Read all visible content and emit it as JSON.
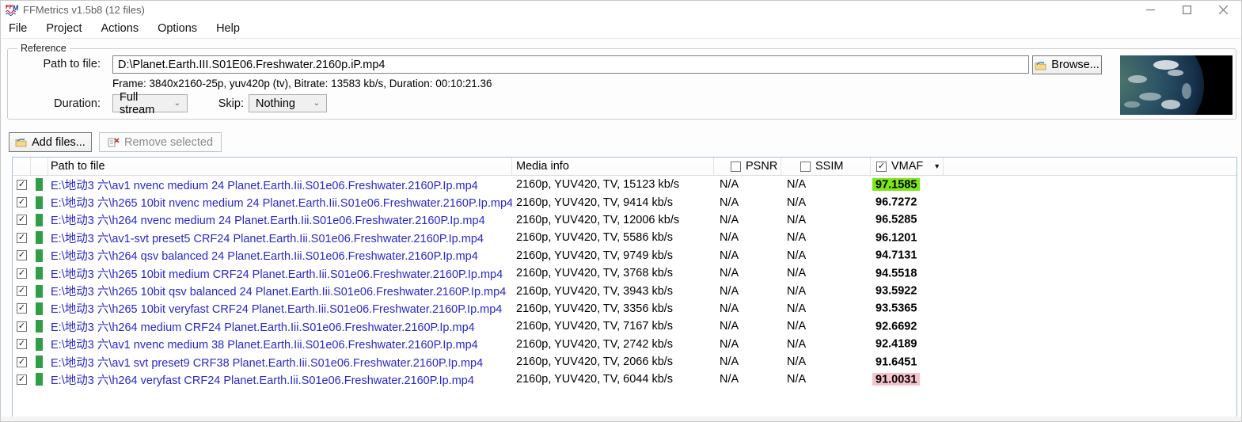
{
  "window": {
    "title": "FFMetrics v1.5b8 (12 files)",
    "icon": "ffmetrics-logo",
    "controls": {
      "minimize": "minimize-button",
      "maximize": "maximize-button",
      "close": "close-button"
    }
  },
  "menu": {
    "items": [
      {
        "label": "File"
      },
      {
        "label": "Project"
      },
      {
        "label": "Actions"
      },
      {
        "label": "Options"
      },
      {
        "label": "Help"
      }
    ]
  },
  "reference": {
    "group_label": "Reference",
    "path_label": "Path to file:",
    "path_value": "D:\\Planet.Earth.III.S01E06.Freshwater.2160p.iP.mp4",
    "browse_label": "Browse...",
    "browse_icon": "open-folder-icon",
    "media_summary": "Frame: 3840x2160-25p, yuv420p (tv), Bitrate: 13583 kb/s, Duration: 00:10:21.36",
    "duration_label": "Duration:",
    "duration_value": "Full stream",
    "skip_label": "Skip:",
    "skip_value": "Nothing",
    "thumbnail": "earth-video-preview"
  },
  "toolbar": {
    "add_files_label": "Add files...",
    "add_files_icon": "open-folder-icon",
    "remove_selected_label": "Remove selected",
    "remove_selected_icon": "remove-list-item-icon",
    "remove_selected_enabled": false
  },
  "table": {
    "headers": {
      "path": "Path to file",
      "media": "Media info",
      "psnr": "PSNR",
      "ssim": "SSIM",
      "vmaf": "VMAF",
      "psnr_checked": false,
      "ssim_checked": false,
      "vmaf_checked": true,
      "sort_indicator": "▼",
      "sorted_by": "VMAF"
    },
    "rows": [
      {
        "checked": true,
        "status_icon": "play-icon",
        "path": "E:\\地动3 六\\av1 nvenc medium 24 Planet.Earth.Iii.S01e06.Freshwater.2160P.Ip.mp4",
        "media": "2160p, YUV420, TV, 15123 kb/s",
        "psnr": "N/A",
        "ssim": "N/A",
        "vmaf": "97.1585",
        "vmaf_highlight": "best"
      },
      {
        "checked": true,
        "status_icon": "play-icon",
        "path": "E:\\地动3 六\\h265 10bit nvenc medium 24 Planet.Earth.Iii.S01e06.Freshwater.2160P.Ip.mp4",
        "media": "2160p, YUV420, TV, 9414 kb/s",
        "psnr": "N/A",
        "ssim": "N/A",
        "vmaf": "96.7272",
        "vmaf_highlight": ""
      },
      {
        "checked": true,
        "status_icon": "play-icon",
        "path": "E:\\地动3 六\\h264 nvenc medium 24 Planet.Earth.Iii.S01e06.Freshwater.2160P.Ip.mp4",
        "media": "2160p, YUV420, TV, 12006 kb/s",
        "psnr": "N/A",
        "ssim": "N/A",
        "vmaf": "96.5285",
        "vmaf_highlight": ""
      },
      {
        "checked": true,
        "status_icon": "play-icon",
        "path": "E:\\地动3 六\\av1-svt preset5 CRF24 Planet.Earth.Iii.S01e06.Freshwater.2160P.Ip.mp4",
        "media": "2160p, YUV420, TV, 5586 kb/s",
        "psnr": "N/A",
        "ssim": "N/A",
        "vmaf": "96.1201",
        "vmaf_highlight": ""
      },
      {
        "checked": true,
        "status_icon": "play-icon",
        "path": "E:\\地动3 六\\h264 qsv balanced 24 Planet.Earth.Iii.S01e06.Freshwater.2160P.Ip.mp4",
        "media": "2160p, YUV420, TV, 9749 kb/s",
        "psnr": "N/A",
        "ssim": "N/A",
        "vmaf": "94.7131",
        "vmaf_highlight": ""
      },
      {
        "checked": true,
        "status_icon": "play-icon",
        "path": "E:\\地动3 六\\h265 10bit medium CRF24 Planet.Earth.Iii.S01e06.Freshwater.2160P.Ip.mp4",
        "media": "2160p, YUV420, TV, 3768 kb/s",
        "psnr": "N/A",
        "ssim": "N/A",
        "vmaf": "94.5518",
        "vmaf_highlight": ""
      },
      {
        "checked": true,
        "status_icon": "play-icon",
        "path": "E:\\地动3 六\\h265 10bit qsv balanced 24 Planet.Earth.Iii.S01e06.Freshwater.2160P.Ip.mp4",
        "media": "2160p, YUV420, TV, 3943 kb/s",
        "psnr": "N/A",
        "ssim": "N/A",
        "vmaf": "93.5922",
        "vmaf_highlight": ""
      },
      {
        "checked": true,
        "status_icon": "play-icon",
        "path": "E:\\地动3 六\\h265 10bit veryfast CRF24 Planet.Earth.Iii.S01e06.Freshwater.2160P.Ip.mp4",
        "media": "2160p, YUV420, TV, 3356 kb/s",
        "psnr": "N/A",
        "ssim": "N/A",
        "vmaf": "93.5365",
        "vmaf_highlight": ""
      },
      {
        "checked": true,
        "status_icon": "play-icon",
        "path": "E:\\地动3 六\\h264 medium CRF24 Planet.Earth.Iii.S01e06.Freshwater.2160P.Ip.mp4",
        "media": "2160p, YUV420, TV, 7167 kb/s",
        "psnr": "N/A",
        "ssim": "N/A",
        "vmaf": "92.6692",
        "vmaf_highlight": ""
      },
      {
        "checked": true,
        "status_icon": "play-icon",
        "path": "E:\\地动3 六\\av1 nvenc medium 38 Planet.Earth.Iii.S01e06.Freshwater.2160P.Ip.mp4",
        "media": "2160p, YUV420, TV, 2742 kb/s",
        "psnr": "N/A",
        "ssim": "N/A",
        "vmaf": "92.4189",
        "vmaf_highlight": ""
      },
      {
        "checked": true,
        "status_icon": "play-icon",
        "path": "E:\\地动3 六\\av1 svt preset9 CRF38 Planet.Earth.Iii.S01e06.Freshwater.2160P.Ip.mp4",
        "media": "2160p, YUV420, TV, 2066 kb/s",
        "psnr": "N/A",
        "ssim": "N/A",
        "vmaf": "91.6451",
        "vmaf_highlight": ""
      },
      {
        "checked": true,
        "status_icon": "play-icon",
        "path": "E:\\地动3 六\\h264 veryfast CRF24 Planet.Earth.Iii.S01e06.Freshwater.2160P.Ip.mp4",
        "media": "2160p, YUV420, TV, 6044 kb/s",
        "psnr": "N/A",
        "ssim": "N/A",
        "vmaf": "91.0031",
        "vmaf_highlight": "worst"
      }
    ]
  },
  "colors": {
    "vmaf_best_bg": "#7CE817",
    "vmaf_worst_bg": "#F7C3CB",
    "file_path_text": "#2828CC",
    "play_icon": "#2F9E44",
    "table_border": "#9DC3E2"
  }
}
